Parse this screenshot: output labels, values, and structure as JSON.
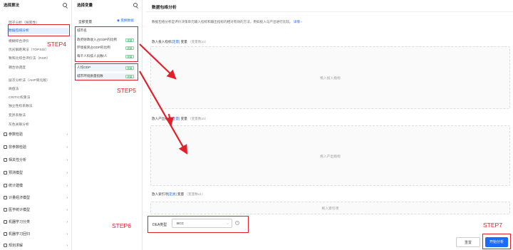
{
  "left": {
    "title": "选择算法",
    "subitems": [
      "因子分析（探索性）",
      "数据包络分析",
      "模糊综合评价",
      "优劣解距离法（TOPSIS）",
      "秩和比综合评价法（RSR）",
      "耦合协调度",
      "层次分析法（AHP简化版）",
      "熵值法",
      "CRITIC权重法",
      "独立性权系数法",
      "变异系数法",
      "灰色关联分析"
    ],
    "categories": [
      "参数检验",
      "非参数检验",
      "相关性分析",
      "预测模型",
      "统计建模",
      "计量经济模型",
      "医学统计模型",
      "机器学习分类",
      "机器学习回归",
      "规划求解"
    ]
  },
  "mid": {
    "title": "选择变量",
    "all_label": "全部变量",
    "transfer_label": "变换数据",
    "variables": [
      {
        "name": "城市名",
        "tag": ""
      },
      {
        "name": "政府财政收入占GDP的比例",
        "tag": "定量"
      },
      {
        "name": "环境投资占GDP的比例",
        "tag": "定量"
      },
      {
        "name": "每千人科技人员数/人",
        "tag": "定量"
      },
      {
        "name": "人均GDP",
        "tag": "定量"
      },
      {
        "name": "城市环境质量指数",
        "tag": "定量"
      }
    ]
  },
  "main": {
    "title": "数据包络分析",
    "description": "数据包络分析是评价决策单元输入指标和输出指标的相对有效的方法，例如投入与产出进行比较。",
    "detail_link": "详情 ›",
    "input_section": {
      "label": "放入投入指标",
      "type": "[定量]",
      "suffix": "变量",
      "note": "（变量数≥1）",
      "placeholder": "拖入投入指标"
    },
    "output_section": {
      "label": "放入产出指标",
      "type": "[定量]",
      "suffix": "变量",
      "note": "（变量数≥1）",
      "placeholder": "拖入产出指标"
    },
    "index_section": {
      "label": "放入索引项",
      "type": "[定类]",
      "suffix": "变量",
      "note": "（变量数≤1）",
      "placeholder": "拖入索引项"
    },
    "dea_label": "DEA类型",
    "dea_value": "BCC",
    "reset_label": "重置",
    "start_label": "开始分析"
  },
  "steps": {
    "s4": "STEP4",
    "s5": "STEP5",
    "s6": "STEP6",
    "s7": "STEP7"
  },
  "colors": {
    "accent": "#1a6cff",
    "annotation": "#e0202a",
    "tag_green": "#2aa35a"
  }
}
